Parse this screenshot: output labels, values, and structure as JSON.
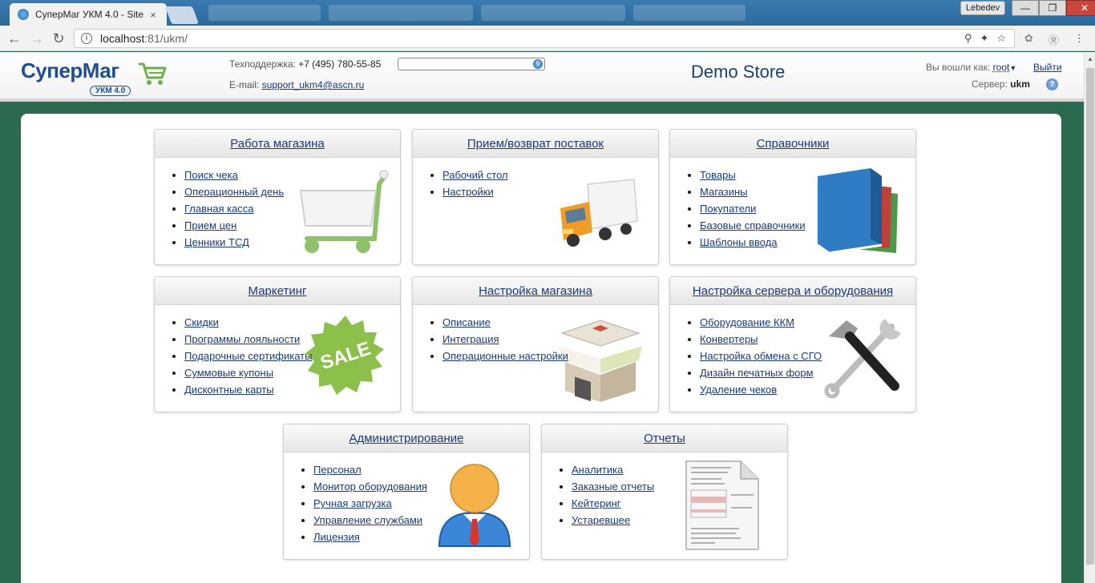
{
  "browser": {
    "tab_title": "СуперМаг УКМ 4.0 - Site",
    "tab_close": "×",
    "user_label": "Lebedev",
    "url_host": "localhost",
    "url_path": ":81/ukm/",
    "min_label": "—",
    "max_label": "❐",
    "close_label": "✕",
    "back_glyph": "←",
    "forward_glyph": "→",
    "reload_glyph": "↻"
  },
  "header": {
    "logo_text": "СуперМаг",
    "logo_badge": "УКМ 4.0",
    "support_label": "Техподдержка:",
    "support_phone": "+7 (495) 780-55-85",
    "email_label": "E-mail:",
    "email": "support_ukm4@ascn.ru",
    "search_placeholder": "",
    "store_name": "Demo Store",
    "logged_in_label": "Вы вошли как:",
    "user": "root",
    "logout": "Выйти",
    "server_label": "Сервер:",
    "server": "ukm",
    "help": "?"
  },
  "cards": [
    {
      "title": "Работа магазина",
      "items": [
        "Поиск чека",
        "Операционный день",
        "Главная касса",
        "Прием цен",
        "Ценники ТСД"
      ]
    },
    {
      "title": "Прием/возврат поставок",
      "items": [
        "Рабочий стол",
        "Настройки"
      ]
    },
    {
      "title": "Справочники",
      "items": [
        "Товары",
        "Магазины",
        "Покупатели",
        "Базовые справочники",
        "Шаблоны ввода"
      ]
    },
    {
      "title": "Маркетинг",
      "items": [
        "Скидки",
        "Программы лояльности",
        "Подарочные сертификаты",
        "Суммовые купоны",
        "Дисконтные карты"
      ]
    },
    {
      "title": "Настройка магазина",
      "items": [
        "Описание",
        "Интеграция",
        "Операционные настройки"
      ]
    },
    {
      "title": "Настройка сервера и оборудования",
      "items": [
        "Оборудование ККМ",
        "Конвертеры",
        "Настройка обмена с СГО",
        "Дизайн печатных форм",
        "Удаление чеков"
      ]
    },
    {
      "title": "Администрирование",
      "items": [
        "Персонал",
        "Монитор оборудования",
        "Ручная загрузка",
        "Управление службами",
        "Лицензия"
      ]
    },
    {
      "title": "Отчеты",
      "items": [
        "Аналитика",
        "Заказные отчеты",
        "Кейтеринг",
        "Устаревшее"
      ]
    }
  ],
  "sale_text": "SALE"
}
